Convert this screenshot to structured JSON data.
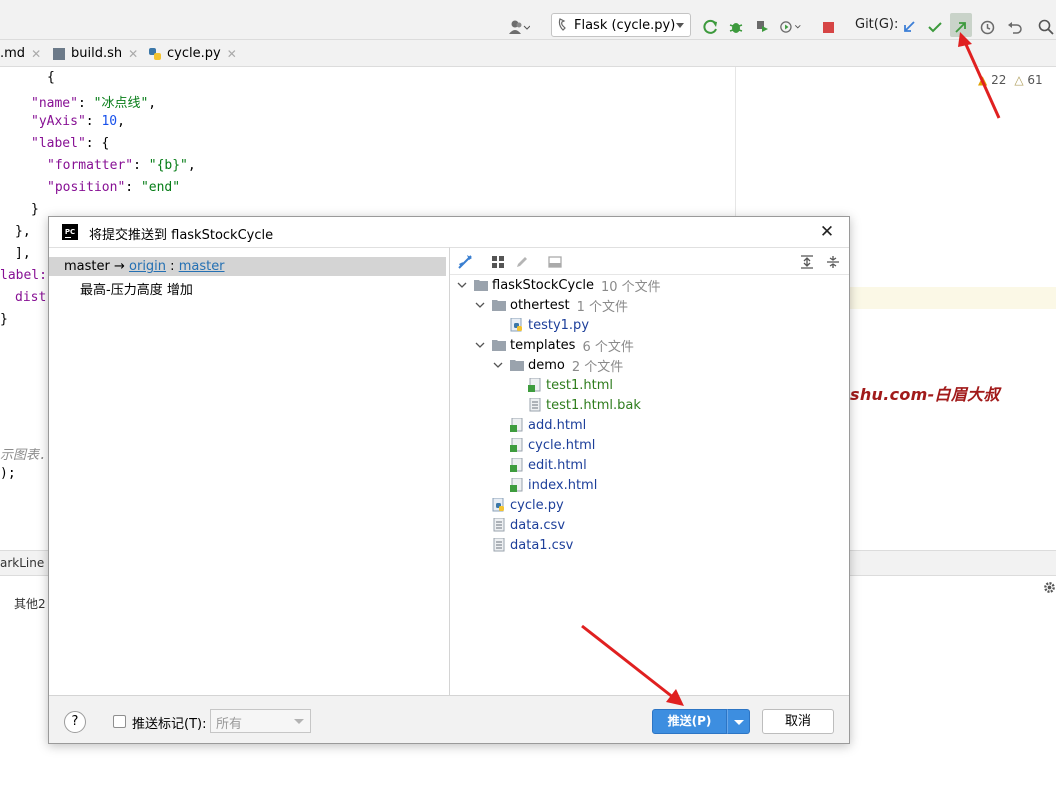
{
  "toolbar": {
    "run_config_label": "Flask (cycle.py)",
    "git_label": "Git(G):"
  },
  "tabs": [
    {
      "label": ".md"
    },
    {
      "label": "build.sh"
    },
    {
      "label": "cycle.py"
    }
  ],
  "editor": {
    "lines": [
      {
        "text": "{"
      },
      {
        "key": "\"name\"",
        "sep": ": ",
        "val": "\"冰点线\"",
        "end": ","
      },
      {
        "key": "\"yAxis\"",
        "sep": ": ",
        "num": "10",
        "end": ","
      },
      {
        "key": "\"label\"",
        "sep": ": {"
      },
      {
        "key": "\"formatter\"",
        "sep": ": ",
        "val": "\"{b}\"",
        "end": ","
      },
      {
        "key": "\"position\"",
        "sep": ": ",
        "val": "\"end\""
      },
      {
        "text": "}"
      },
      {
        "text": "},"
      },
      {
        "text": "],"
      },
      {
        "text": "label:"
      },
      {
        "text": "dist"
      },
      {
        "text": "}"
      },
      {
        "text": "示图表."
      },
      {
        "text": ");"
      }
    ]
  },
  "warnings": {
    "errors": "22",
    "warnings": "61"
  },
  "watermark": "www.baimeidashu.com-白眉大叔",
  "bottom": {
    "tab_label": "arkLine",
    "text": "其他2"
  },
  "dialog": {
    "title": "将提交推送到 flaskStockCycle",
    "app_icon": "PC",
    "branch": {
      "local": "master",
      "arrow": " → ",
      "remote": "origin",
      "colon": " : ",
      "remote_branch": "master"
    },
    "commit_message": "最高-压力高度 增加",
    "tree": [
      {
        "name": "flaskStockCycle",
        "count": "10 个文件",
        "kind": "folder"
      },
      {
        "name": "othertest",
        "count": "1 个文件",
        "kind": "folder"
      },
      {
        "name": "testy1.py",
        "kind": "py"
      },
      {
        "name": "templates",
        "count": "6 个文件",
        "kind": "folder"
      },
      {
        "name": "demo",
        "count": "2 个文件",
        "kind": "folder"
      },
      {
        "name": "test1.html",
        "kind": "html"
      },
      {
        "name": "test1.html.bak",
        "kind": "html"
      },
      {
        "name": "add.html",
        "kind": "html"
      },
      {
        "name": "cycle.html",
        "kind": "html"
      },
      {
        "name": "edit.html",
        "kind": "html"
      },
      {
        "name": "index.html",
        "kind": "html"
      },
      {
        "name": "cycle.py",
        "kind": "py"
      },
      {
        "name": "data.csv",
        "kind": "csv"
      },
      {
        "name": "data1.csv",
        "kind": "csv"
      }
    ],
    "footer": {
      "help": "?",
      "push_tags_label": "推送标记(T):",
      "tags_select_value": "所有",
      "push_button": "推送(P)",
      "cancel_button": "取消"
    }
  }
}
